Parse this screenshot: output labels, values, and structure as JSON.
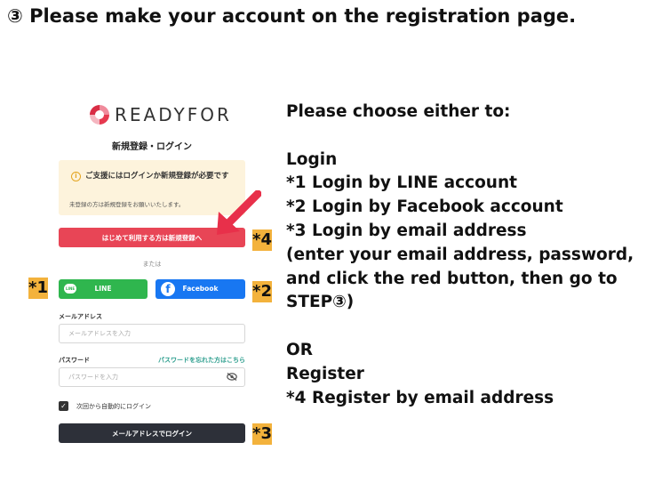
{
  "heading": "③ Please make your account on the registration page.",
  "brand": {
    "name": "READYFOR",
    "logo_letter": "R"
  },
  "page": {
    "subtitle": "新規登録・ログイン",
    "notice": {
      "icon": "info-icon",
      "title": "ご支援にはログインか新規登録が必要です",
      "body": "未登録の方は新規登録をお願いいたします。"
    },
    "register_button": "はじめて利用する方は新規登録へ",
    "or_text": "または",
    "line_button": "LINE",
    "line_icon_text": "LINE",
    "facebook_button": "Facebook",
    "facebook_icon_text": "f",
    "email_label": "メールアドレス",
    "email_placeholder": "メールアドレスを入力",
    "password_label": "パスワード",
    "forgot_link": "パスワードを忘れた方はこちら",
    "password_placeholder": "パスワードを入力",
    "remember_checked": true,
    "remember_label": "次回から自動的にログイン",
    "login_button": "メールアドレスでログイン"
  },
  "markers": {
    "m1": "*1",
    "m2": "*2",
    "m3": "*3",
    "m4": "*4"
  },
  "colors": {
    "register_red": "#e84556",
    "line_green": "#2fb64e",
    "facebook_blue": "#1877f2",
    "marker_yellow": "#f3b23c",
    "arrow_red": "#e8304a"
  },
  "instructions": [
    "Please choose either to:",
    "",
    "Login",
    "*1 Login by LINE account",
    "*2 Login by Facebook account",
    "*3 Login by email address",
    "(enter your email address, password,",
    "and click the red button, then go to",
    "STEP③)",
    "",
    "OR",
    "Register",
    "*4  Register by email address"
  ]
}
